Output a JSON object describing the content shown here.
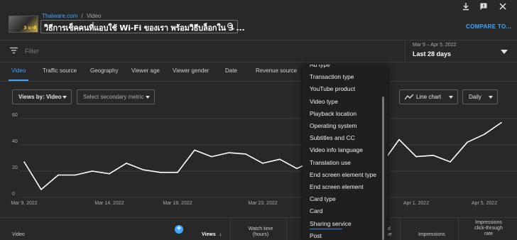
{
  "header": {
    "channel": "Thaiware.com",
    "separator": "/",
    "section": "Video",
    "video_title": "วิธีการเช็คคนที่แอบใช้ Wi-Fi ของเรา พร้อมวิธีบล็อกใน 3 ...",
    "thumbnail_badge": "3 นาที",
    "compare_label": "COMPARE TO..."
  },
  "filter": {
    "placeholder": "Filter"
  },
  "date": {
    "range": "Mar 9 – Apr 5, 2022",
    "selected": "Last 28 days"
  },
  "tabs": [
    "Video",
    "Traffic source",
    "Geography",
    "Viewer age",
    "Viewer gender",
    "Date",
    "Revenue source"
  ],
  "controls": {
    "views_by": "Views by: Video",
    "secondary_metric": "Select secondary metric",
    "chart_type": "Line chart",
    "granularity": "Daily"
  },
  "dropdown": {
    "items": [
      "Ad type",
      "Transaction type",
      "YouTube product",
      "Video type",
      "Playback location",
      "Operating system",
      "Subtitles and CC",
      "Video info language",
      "Translation use",
      "End screen element type",
      "End screen element",
      "Card type",
      "Card",
      "Sharing service",
      "Post"
    ]
  },
  "table": {
    "video_header": "Video",
    "views_header": "Views",
    "watch_time_header": [
      "Watch time",
      "(hours)"
    ],
    "partial_header": [
      "ted",
      "nue"
    ],
    "impressions_header": "Impressions",
    "ctr_header": [
      "Impressions",
      "click-through",
      "rate"
    ]
  },
  "colors": {
    "accent": "#3ea6ff",
    "background": "#282828",
    "line": "#ffffff"
  },
  "chart_data": {
    "type": "line",
    "x": [
      "Mar 9, 2022",
      "Mar 10, 2022",
      "Mar 11, 2022",
      "Mar 12, 2022",
      "Mar 13, 2022",
      "Mar 14, 2022",
      "Mar 15, 2022",
      "Mar 16, 2022",
      "Mar 17, 2022",
      "Mar 18, 2022",
      "Mar 19, 2022",
      "Mar 20, 2022",
      "Mar 21, 2022",
      "Mar 22, 2022",
      "Mar 23, 2022",
      "Mar 24, 2022",
      "Mar 25, 2022",
      "Mar 26, 2022",
      "Mar 27, 2022",
      "Mar 28, 2022",
      "Mar 29, 2022",
      "Mar 30, 2022",
      "Mar 31, 2022",
      "Apr 1, 2022",
      "Apr 2, 2022",
      "Apr 3, 2022",
      "Apr 4, 2022",
      "Apr 5, 2022"
    ],
    "series": [
      {
        "values": [
          27,
          6,
          17,
          17,
          20,
          18,
          26,
          21,
          19,
          19,
          36,
          31,
          34,
          33,
          26,
          29,
          22,
          28,
          32,
          34,
          28,
          26,
          44,
          31,
          32,
          27,
          42,
          48,
          57
        ]
      }
    ],
    "y_ticks": [
      "60",
      "40",
      "20",
      "0"
    ],
    "x_tick_labels": [
      "Mar 9, 2022",
      "Mar 14, 2022",
      "Mar 18, 2022",
      "Mar 23, 2022",
      "Apr 1, 2022",
      "Apr 5, 2022"
    ],
    "ylim": [
      0,
      60
    ],
    "grid": true
  }
}
